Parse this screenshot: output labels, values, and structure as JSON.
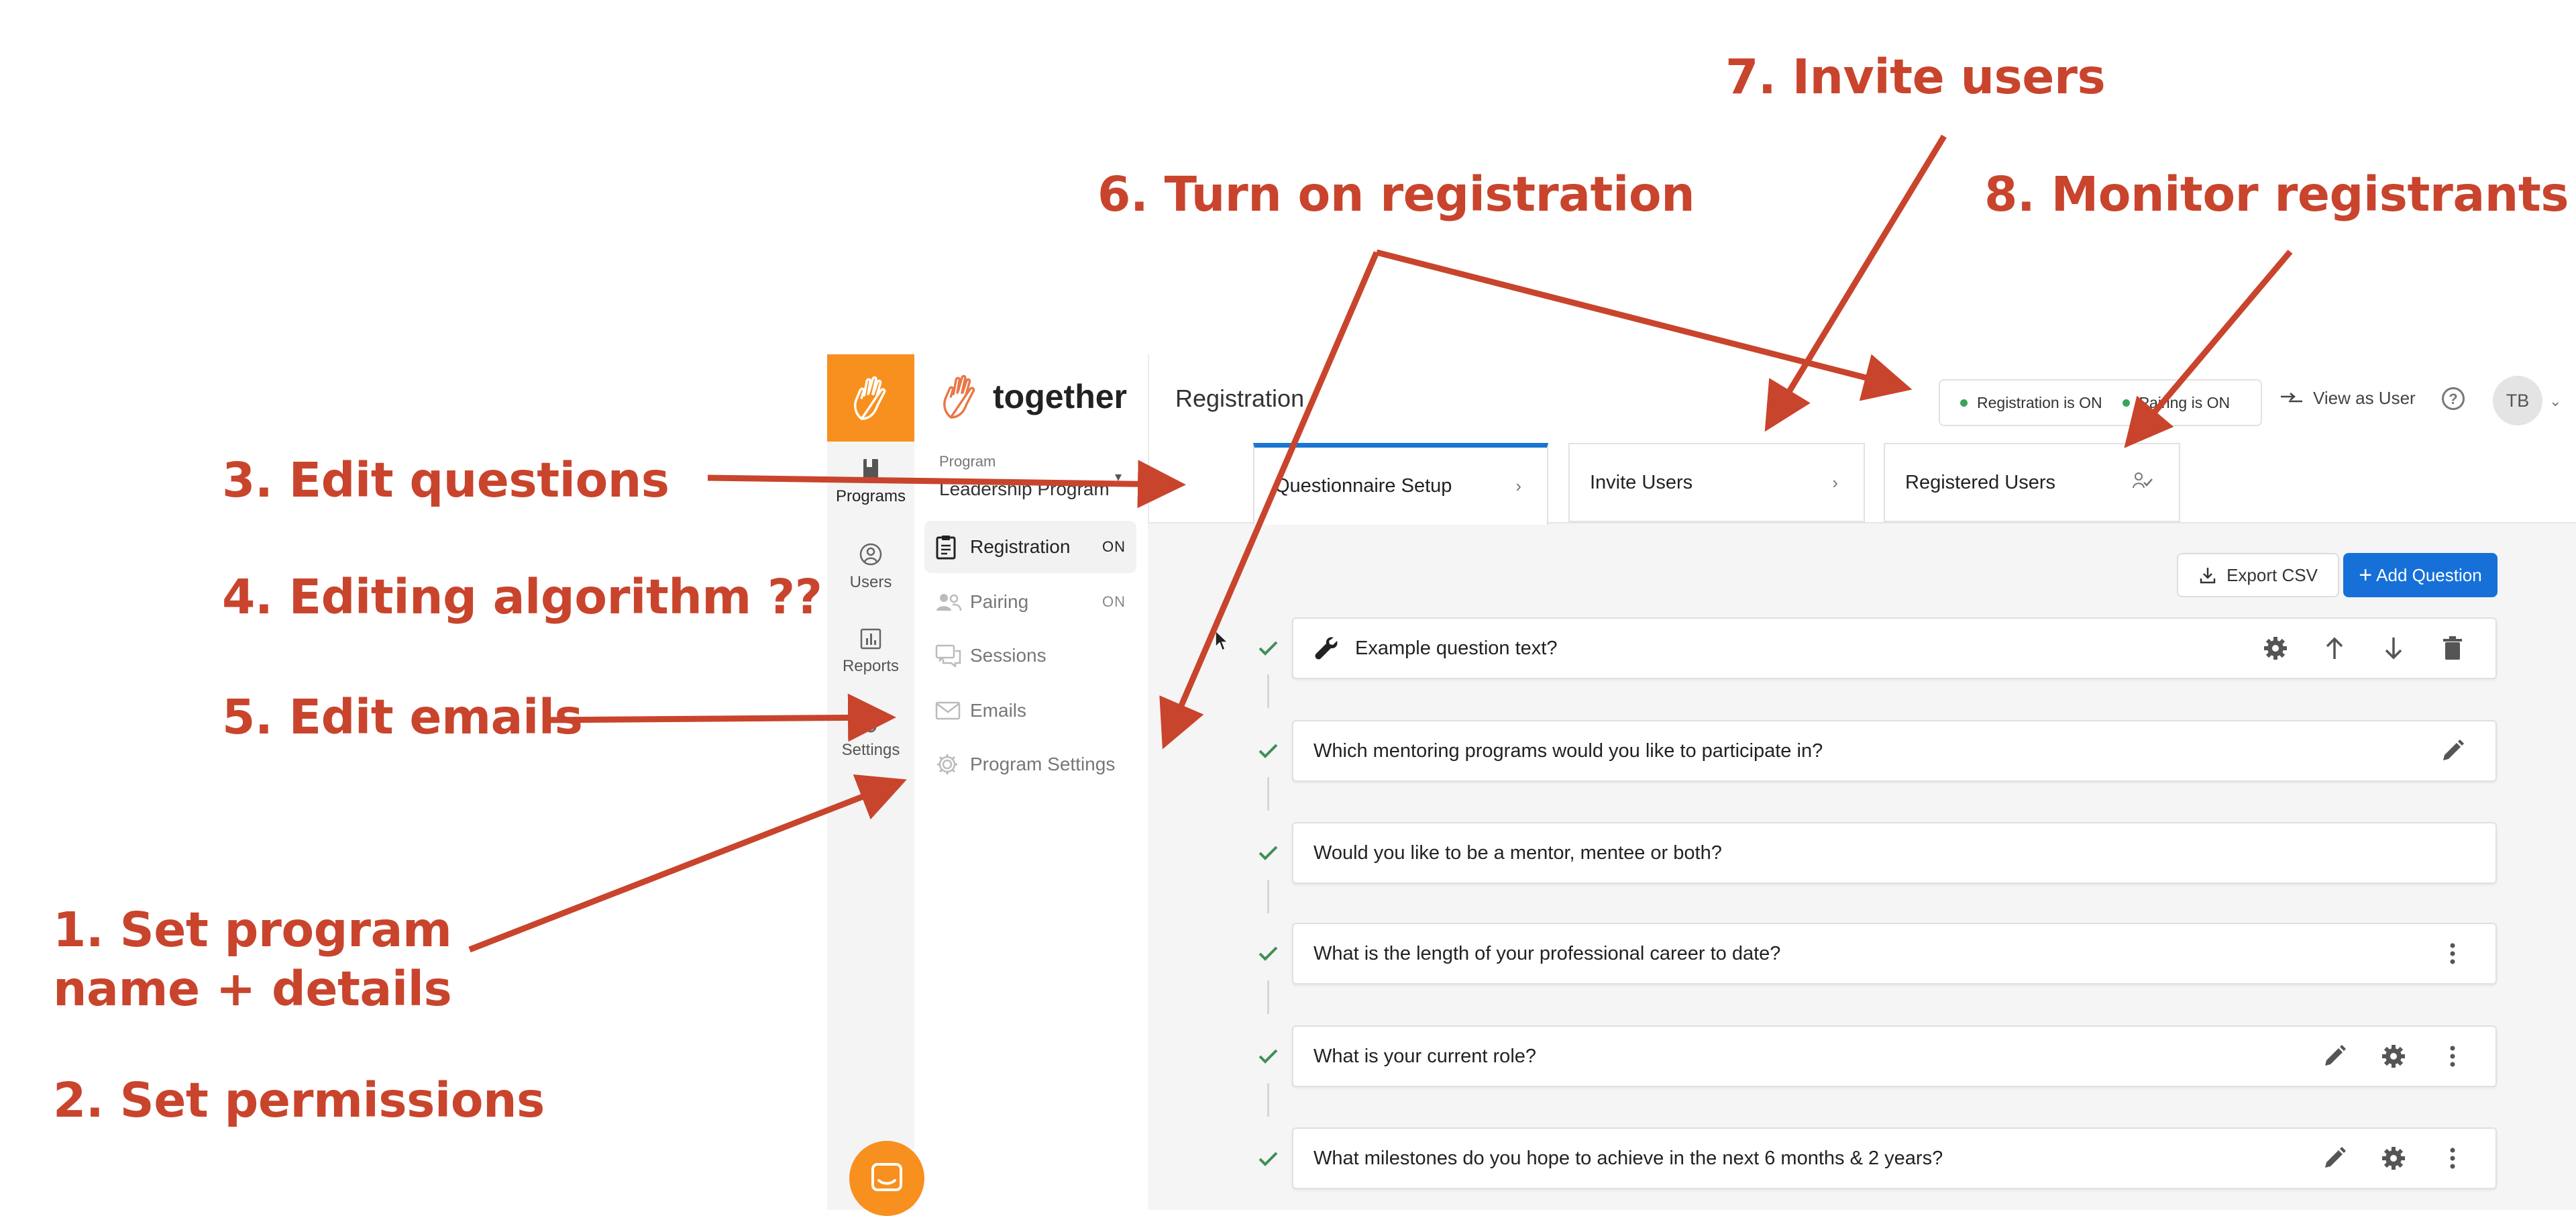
{
  "annotations": {
    "a1_line1": "1. Set program",
    "a1_line2": "name + details",
    "a2": "2. Set permissions",
    "a3": "3. Edit questions",
    "a4": "4. Editing algorithm ??",
    "a5": "5. Edit emails",
    "a6": "6. Turn on registration",
    "a7": "7. Invite users",
    "a8": "8. Monitor registrants",
    "color": "#c9442c"
  },
  "rail": {
    "items": [
      {
        "label": "Programs",
        "icon": "book-icon"
      },
      {
        "label": "Users",
        "icon": "user-circle-icon"
      },
      {
        "label": "Reports",
        "icon": "bar-chart-icon"
      },
      {
        "label": "Settings",
        "icon": "gear-icon"
      }
    ],
    "accent": "#f7901e"
  },
  "brand": {
    "name": "together",
    "icon": "hand-wave-icon"
  },
  "program": {
    "label": "Program",
    "name": "Leadership Program"
  },
  "nav": [
    {
      "label": "Registration",
      "status": "ON",
      "icon": "clipboard-icon"
    },
    {
      "label": "Pairing",
      "status": "ON",
      "icon": "users-pair-icon"
    },
    {
      "label": "Sessions",
      "status": "",
      "icon": "chat-bubbles-icon"
    },
    {
      "label": "Emails",
      "status": "",
      "icon": "envelope-icon"
    },
    {
      "label": "Program Settings",
      "status": "",
      "icon": "gear-icon"
    }
  ],
  "header": {
    "title": "Registration",
    "registration_status": "Registration is ON",
    "pairing_status": "Pairing is ON",
    "view_as_user": "View as User",
    "avatar_initials": "TB"
  },
  "tabs": [
    {
      "label": "Questionnaire Setup",
      "icon": "chevron-right-icon"
    },
    {
      "label": "Invite Users",
      "icon": "chevron-right-icon"
    },
    {
      "label": "Registered Users",
      "icon": "user-check-icon"
    }
  ],
  "toolbar": {
    "export_label": "Export CSV",
    "add_label": "Add Question",
    "add_plus": "+",
    "primary": "#1670d8"
  },
  "questions": [
    {
      "text": "Example question text?",
      "actions": [
        "gear-icon",
        "arrow-up-icon",
        "arrow-down-icon",
        "trash-icon"
      ]
    },
    {
      "text": "Which mentoring programs would you like to participate in?",
      "actions": [
        "pencil-icon"
      ]
    },
    {
      "text": "Would you like to be a mentor, mentee or both?",
      "actions": []
    },
    {
      "text": "What is the length of your professional career to date?",
      "actions": [
        "more-vertical-icon"
      ]
    },
    {
      "text": "What is your current role?",
      "actions": [
        "pencil-icon",
        "gear-icon",
        "more-vertical-icon"
      ]
    },
    {
      "text": "What milestones do you hope to achieve in the next 6 months & 2 years?",
      "actions": [
        "pencil-icon",
        "gear-icon",
        "more-vertical-icon"
      ]
    }
  ],
  "status_color": "#3aa55a"
}
